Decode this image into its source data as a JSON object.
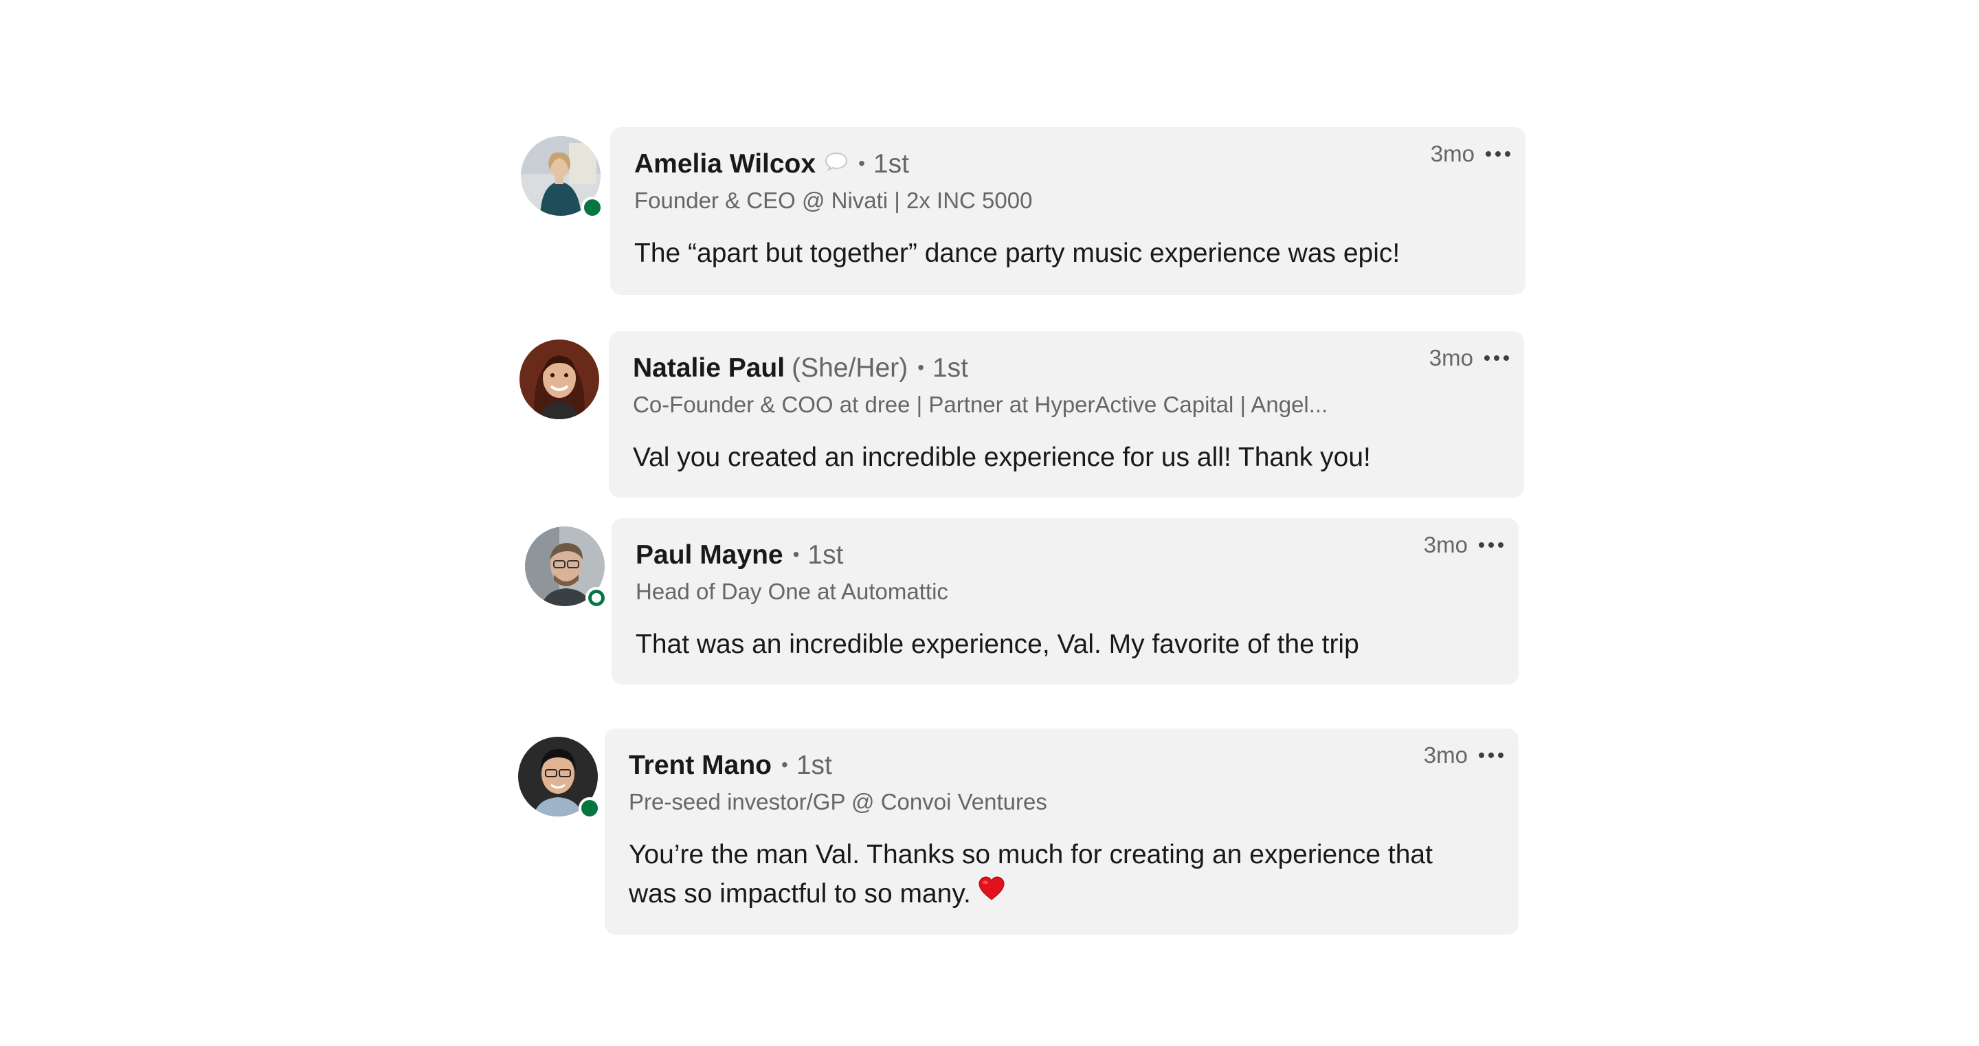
{
  "comments": [
    {
      "name": "Amelia Wilcox",
      "pronouns": "",
      "connection": "1st",
      "separator": "•",
      "headline": "Founder & CEO @ Nivati | 2x INC 5000",
      "time": "3mo",
      "text": "The “apart but together” dance party music experience was epic!",
      "text_line2": "",
      "presence": "active",
      "status_icon": "speech-bubble-icon"
    },
    {
      "name": "Natalie Paul",
      "pronouns": "(She/Her)",
      "connection": "1st",
      "separator": "•",
      "headline": "Co-Founder & COO at dree | Partner at HyperActive Capital | Angel...",
      "time": "3mo",
      "text": "Val you created an incredible experience for us all! Thank you!",
      "text_line2": "",
      "presence": "none"
    },
    {
      "name": "Paul Mayne",
      "pronouns": "",
      "connection": "1st",
      "separator": "•",
      "headline": "Head of Day One at Automattic",
      "time": "3mo",
      "text": "That was an incredible experience, Val. My favorite of the trip",
      "text_line2": "",
      "presence": "away"
    },
    {
      "name": "Trent Mano",
      "pronouns": "",
      "connection": "1st",
      "separator": "•",
      "headline": "Pre-seed investor/GP @ Convoi Ventures",
      "time": "3mo",
      "text": "You’re the man Val. Thanks so much for creating an experience that",
      "text_line2": "was so impactful to so many.",
      "presence": "active",
      "emoji": "red-heart-icon"
    }
  ],
  "colors": {
    "bubble_bg": "#f2f2f2",
    "presence_green": "#057642",
    "secondary_text": "#666666",
    "primary_text": "#191919",
    "heart_red": "#e0121b"
  }
}
